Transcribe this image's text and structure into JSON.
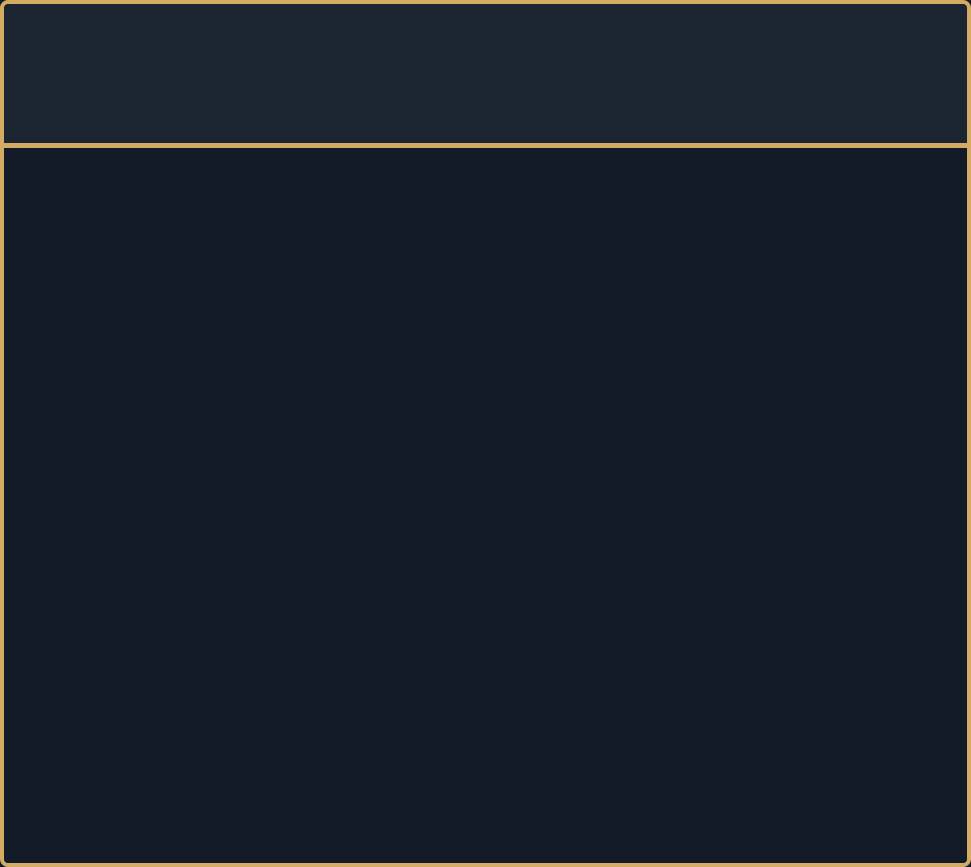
{
  "theme": {
    "frame_color": "#d4ab62",
    "header_background": "#1c2532",
    "content_background": "#131b29"
  },
  "header": {
    "title": ""
  },
  "main": {
    "content": ""
  }
}
